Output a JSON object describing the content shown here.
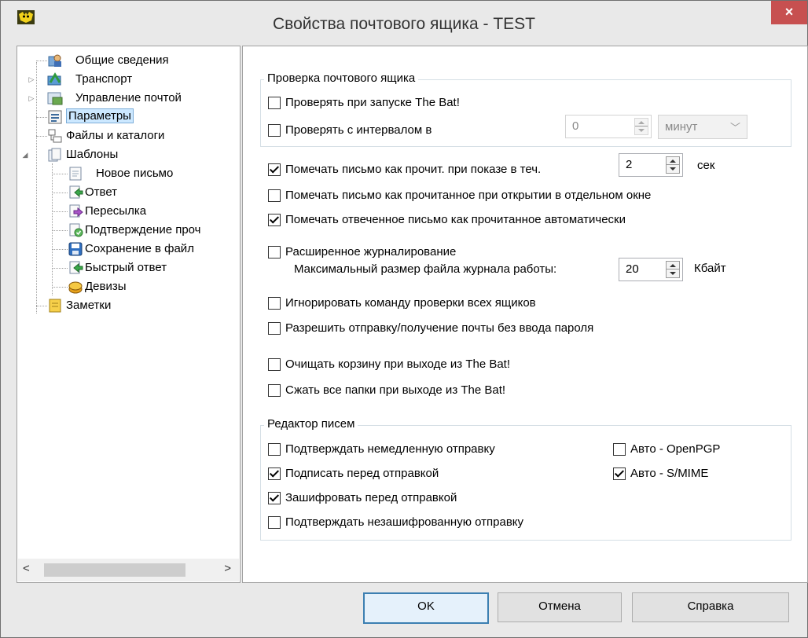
{
  "window": {
    "title": "Свойства почтового ящика - TEST",
    "close_glyph": "×",
    "app_icon": "bat-icon"
  },
  "tree": {
    "items": [
      {
        "label": "Общие сведения",
        "icon": "user-card-icon"
      },
      {
        "label": "Транспорт",
        "icon": "transport-icon",
        "expander": "▷"
      },
      {
        "label": "Управление почтой",
        "icon": "mail-management-icon",
        "expander": "▷"
      },
      {
        "label": "Параметры",
        "icon": "parameters-icon"
      },
      {
        "label": "Файлы и каталоги",
        "icon": "folders-icon"
      },
      {
        "label": "Шаблоны",
        "icon": "templates-icon",
        "expander": "◢"
      },
      {
        "label": "Новое письмо",
        "icon": "new-letter-icon"
      },
      {
        "label": "Ответ",
        "icon": "reply-icon"
      },
      {
        "label": "Пересылка",
        "icon": "forward-icon"
      },
      {
        "label": "Подтверждение проч",
        "icon": "read-confirm-icon"
      },
      {
        "label": "Сохранение в файл",
        "icon": "save-file-icon"
      },
      {
        "label": "Быстрый ответ",
        "icon": "quick-reply-icon"
      },
      {
        "label": "Девизы",
        "icon": "mottos-icon"
      },
      {
        "label": "Заметки",
        "icon": "notes-icon"
      }
    ],
    "scroll_left": "<",
    "scroll_right": ">"
  },
  "check_group": {
    "title": "Проверка почтового ящика",
    "on_start": {
      "label": "Проверять при запуске The Bat!",
      "checked": false
    },
    "interval": {
      "label": "Проверять с интервалом в",
      "checked": false,
      "value": "0",
      "unit": "минут"
    }
  },
  "options": {
    "mark_read_preview": {
      "label": "Помечать письмо как прочит. при показе в теч.",
      "checked": true,
      "value": "2",
      "unit": "сек"
    },
    "mark_read_window": {
      "label": "Помечать письмо как прочитанное при открытии в отдельном окне",
      "checked": false
    },
    "mark_replied_read": {
      "label": "Помечать отвеченное письмо как прочитанное автоматически",
      "checked": true
    },
    "extended_log": {
      "label": "Расширенное журналирование",
      "checked": false
    },
    "log_size": {
      "label": "Максимальный размер файла журнала работы:",
      "value": "20",
      "unit": "Кбайт"
    },
    "ignore_check_all": {
      "label": "Игнорировать команду проверки всех ящиков",
      "checked": false
    },
    "no_password": {
      "label": "Разрешить отправку/получение почты без ввода пароля",
      "checked": false
    },
    "empty_trash": {
      "label": "Очищать корзину при выходе из The Bat!",
      "checked": false
    },
    "compress_folders": {
      "label": "Сжать все папки при выходе из The Bat!",
      "checked": false
    }
  },
  "editor_group": {
    "title": "Редактор писем",
    "confirm_send": {
      "label": "Подтверждать немедленную отправку",
      "checked": false
    },
    "sign": {
      "label": "Подписать перед отправкой",
      "checked": true
    },
    "encrypt": {
      "label": "Зашифровать перед отправкой",
      "checked": true
    },
    "confirm_unencrypted": {
      "label": "Подтверждать незашифрованную отправку",
      "checked": false
    },
    "auto_openpgp": {
      "label": "Авто - OpenPGP",
      "checked": false
    },
    "auto_smime": {
      "label": "Авто - S/MIME",
      "checked": true
    }
  },
  "buttons": {
    "ok": "OK",
    "cancel": "Отмена",
    "help": "Справка"
  }
}
